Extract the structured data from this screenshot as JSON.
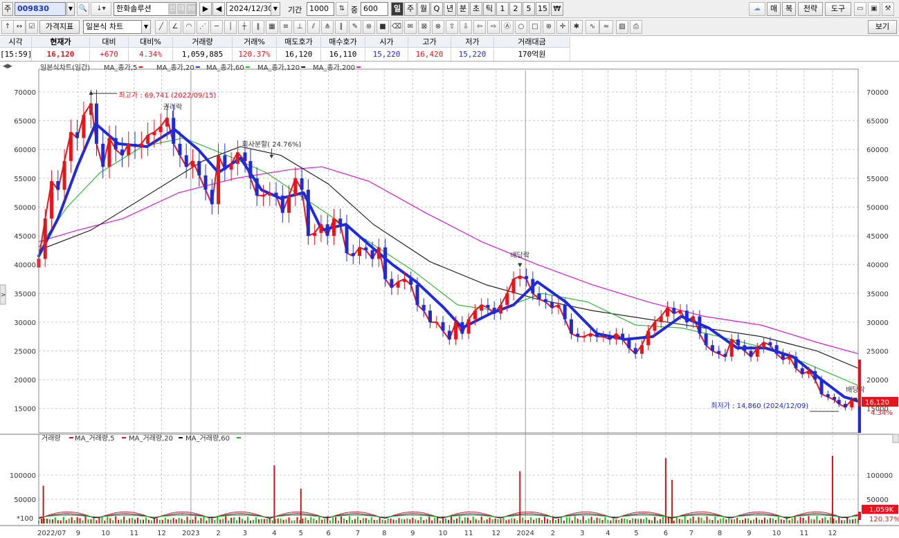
{
  "toolbar": {
    "market_label": "주",
    "code": "009830",
    "stock_name": "한화솔루션",
    "badge1": "신",
    "badge2": "대",
    "badge3": "30",
    "date": "2024/12/30",
    "period_label": "기간",
    "period_value": "1000",
    "count_label": "중",
    "count_value": "600",
    "periods": [
      "일",
      "주",
      "월",
      "Q",
      "년",
      "분",
      "초",
      "틱",
      "1",
      "2",
      "5",
      "15",
      "₩"
    ],
    "right_buttons": [
      "매",
      "복",
      "전략",
      "도구"
    ],
    "price_indicator": "가격지표",
    "chart_type": "일본식 차트",
    "view_button": "보기"
  },
  "quote": {
    "headers": [
      "시각",
      "현재가",
      "대비",
      "대비%",
      "거래량",
      "거래%",
      "매도호가",
      "매수호가",
      "시가",
      "고가",
      "저가",
      "거래대금"
    ],
    "values": [
      "[15:59]",
      "16,120",
      "+670",
      "4.34%",
      "1,059,885",
      "120.37%",
      "16,120",
      "16,110",
      "15,220",
      "16,420",
      "15,220",
      "170억원"
    ]
  },
  "colors": {
    "up": "#e8141c",
    "down": "#1f2ad8",
    "ma5": "#e8141c",
    "ma20": "#1f2ad8",
    "ma60": "#22b522",
    "ma120": "#111111",
    "ma200": "#d21ad2",
    "vol_up": "#c8141c",
    "vol_down": "#22b522",
    "vol_ma5": "#c8141c",
    "vol_ma20": "#111111",
    "vol_ma60": "#22b522"
  },
  "price_panel": {
    "legend_prefix": "일본식차트(일간)",
    "legend_items": [
      "MA_종가,5",
      "MA_종가,20",
      "MA_종가,60",
      "MA_종가,120",
      "MA_종가,200"
    ],
    "last_price_label": "16,120",
    "last_change_label": "4.34%"
  },
  "volume_panel": {
    "legend_prefix": "거래량",
    "legend_items": [
      "MA_거래량,5",
      "MA_거래량,20",
      "MA_거래량,60"
    ],
    "unit_label": "*100",
    "last_volume_label": "1,059K",
    "last_volume_pct": "120.37%"
  },
  "chart_data": {
    "type": "candlestick",
    "y_ticks": [
      15000,
      20000,
      25000,
      30000,
      35000,
      40000,
      45000,
      50000,
      55000,
      60000,
      65000,
      70000
    ],
    "ylim": [
      11000,
      73000
    ],
    "volume_ticks": [
      50000,
      100000
    ],
    "volume_ylim": [
      0,
      160000
    ],
    "x_labels": [
      "2022/07",
      "9",
      "10",
      "11",
      "12",
      "2023",
      "2",
      "3",
      "4",
      "5",
      "6",
      "7",
      "8",
      "9",
      "10",
      "11",
      "12",
      "2024",
      "2",
      "3",
      "4",
      "5",
      "6",
      "7",
      "8",
      "9",
      "10",
      "11",
      "12"
    ],
    "xlim": [
      "2022-07-20",
      "2024-12-30"
    ],
    "label_dates": [
      "2022-07-20",
      "2022-09-01",
      "2022-10-01",
      "2022-11-01",
      "2022-12-01",
      "2023-01-02",
      "2023-02-01",
      "2023-03-02",
      "2023-04-03",
      "2023-05-02",
      "2023-06-01",
      "2023-07-03",
      "2023-08-01",
      "2023-09-01",
      "2023-10-04",
      "2023-11-01",
      "2023-12-01",
      "2024-01-02",
      "2024-02-01",
      "2024-03-04",
      "2024-04-01",
      "2024-05-02",
      "2024-06-03",
      "2024-07-01",
      "2024-08-01",
      "2024-09-02",
      "2024-10-02",
      "2024-11-01",
      "2024-12-02"
    ],
    "price_series": {
      "name": "종가",
      "dates": [
        "2022-07-20",
        "2022-07-27",
        "2022-08-03",
        "2022-08-10",
        "2022-08-17",
        "2022-08-24",
        "2022-08-31",
        "2022-09-07",
        "2022-09-15",
        "2022-09-21",
        "2022-09-28",
        "2022-10-05",
        "2022-10-12",
        "2022-10-19",
        "2022-10-26",
        "2022-11-02",
        "2022-11-09",
        "2022-11-16",
        "2022-11-23",
        "2022-11-30",
        "2022-12-07",
        "2022-12-14",
        "2022-12-21",
        "2022-12-28",
        "2023-01-04",
        "2023-01-11",
        "2023-01-18",
        "2023-01-25",
        "2023-02-01",
        "2023-02-08",
        "2023-02-15",
        "2023-02-22",
        "2023-03-02",
        "2023-03-08",
        "2023-03-15",
        "2023-03-22",
        "2023-03-29",
        "2023-04-05",
        "2023-04-12",
        "2023-04-19",
        "2023-04-26",
        "2023-05-03",
        "2023-05-10",
        "2023-05-17",
        "2023-05-24",
        "2023-05-31",
        "2023-06-07",
        "2023-06-14",
        "2023-06-21",
        "2023-06-28",
        "2023-07-05",
        "2023-07-12",
        "2023-07-19",
        "2023-07-26",
        "2023-08-02",
        "2023-08-09",
        "2023-08-16",
        "2023-08-23",
        "2023-08-30",
        "2023-09-06",
        "2023-09-13",
        "2023-09-20",
        "2023-09-27",
        "2023-10-04",
        "2023-10-11",
        "2023-10-18",
        "2023-10-25",
        "2023-11-01",
        "2023-11-08",
        "2023-11-15",
        "2023-11-22",
        "2023-11-29",
        "2023-12-06",
        "2023-12-13",
        "2023-12-20",
        "2023-12-27",
        "2024-01-03",
        "2024-01-10",
        "2024-01-17",
        "2024-01-24",
        "2024-01-31",
        "2024-02-07",
        "2024-02-14",
        "2024-02-21",
        "2024-02-28",
        "2024-03-06",
        "2024-03-13",
        "2024-03-20",
        "2024-03-27",
        "2024-04-03",
        "2024-04-10",
        "2024-04-17",
        "2024-04-24",
        "2024-05-01",
        "2024-05-08",
        "2024-05-15",
        "2024-05-22",
        "2024-05-29",
        "2024-06-05",
        "2024-06-12",
        "2024-06-19",
        "2024-06-26",
        "2024-07-03",
        "2024-07-10",
        "2024-07-17",
        "2024-07-24",
        "2024-07-31",
        "2024-08-07",
        "2024-08-14",
        "2024-08-21",
        "2024-08-28",
        "2024-09-04",
        "2024-09-11",
        "2024-09-18",
        "2024-09-25",
        "2024-10-02",
        "2024-10-09",
        "2024-10-16",
        "2024-10-23",
        "2024-10-30",
        "2024-11-06",
        "2024-11-13",
        "2024-11-20",
        "2024-11-27",
        "2024-12-04",
        "2024-12-09",
        "2024-12-16",
        "2024-12-23",
        "2024-12-30"
      ],
      "close": [
        41000,
        48000,
        54500,
        53000,
        58000,
        63000,
        62000,
        66000,
        68000,
        61000,
        57000,
        62000,
        60000,
        59000,
        61000,
        60500,
        61000,
        62500,
        63000,
        64000,
        65500,
        61000,
        59000,
        57000,
        58000,
        55500,
        53000,
        50500,
        59000,
        56500,
        57500,
        59500,
        58000,
        55000,
        52000,
        52000,
        52500,
        52000,
        49000,
        52000,
        55000,
        53000,
        45000,
        45500,
        47000,
        45000,
        48000,
        47000,
        42000,
        41500,
        43000,
        42500,
        41000,
        43000,
        37500,
        36000,
        37000,
        37500,
        36500,
        33000,
        32000,
        30000,
        30000,
        28500,
        27000,
        30000,
        28000,
        30500,
        32000,
        33000,
        32500,
        31500,
        33000,
        35000,
        37500,
        38000,
        37500,
        35000,
        34000,
        33500,
        32500,
        33000,
        30500,
        28000,
        27500,
        27500,
        28000,
        27500,
        27500,
        27000,
        28000,
        27000,
        25500,
        24500,
        26000,
        28500,
        30000,
        31000,
        32500,
        31500,
        32000,
        30000,
        31000,
        28000,
        26000,
        25000,
        24500,
        24000,
        27000,
        26000,
        25000,
        24000,
        25500,
        26500,
        26000,
        24500,
        23500,
        24000,
        22000,
        21000,
        21500,
        20000,
        17500,
        17000,
        16500,
        15800,
        15200,
        16500,
        16120
      ]
    },
    "annotations": [
      {
        "text": "최고가 : 69,741 (2022/09/15)",
        "date": "2022-09-15",
        "value": 69741
      },
      {
        "text": "권리락",
        "date": "2022-12-13",
        "value": 66500
      },
      {
        "text": "회사분할( 24.76%)",
        "date": "2023-03-31",
        "value": 59800
      },
      {
        "text": "배당락",
        "date": "2023-12-27",
        "value": 40500
      },
      {
        "text": "최저가 : 14,860 (2024/12/09)",
        "date": "2024-12-09",
        "value": 14860
      },
      {
        "text": "배당락",
        "date": "2024-12-27",
        "value": 17100
      }
    ],
    "ma200_points": [
      [
        "2022-07-20",
        44000
      ],
      [
        "2022-09-01",
        46000
      ],
      [
        "2022-10-20",
        48000
      ],
      [
        "2022-12-20",
        52500
      ],
      [
        "2023-02-20",
        55000
      ],
      [
        "2023-04-20",
        56500
      ],
      [
        "2023-05-25",
        57000
      ],
      [
        "2023-07-15",
        54500
      ],
      [
        "2023-09-15",
        49000
      ],
      [
        "2023-11-15",
        44000
      ],
      [
        "2024-01-15",
        40000
      ],
      [
        "2024-03-15",
        36500
      ],
      [
        "2024-05-15",
        33500
      ],
      [
        "2024-07-15",
        31000
      ],
      [
        "2024-09-15",
        29500
      ],
      [
        "2024-11-15",
        26500
      ],
      [
        "2024-12-30",
        24500
      ]
    ],
    "ma120_points": [
      [
        "2022-07-20",
        42500
      ],
      [
        "2022-09-15",
        46000
      ],
      [
        "2022-11-15",
        52000
      ],
      [
        "2023-01-15",
        58000
      ],
      [
        "2023-02-25",
        60500
      ],
      [
        "2023-04-10",
        59000
      ],
      [
        "2023-06-01",
        54000
      ],
      [
        "2023-07-20",
        47000
      ],
      [
        "2023-09-20",
        40500
      ],
      [
        "2023-11-20",
        36500
      ],
      [
        "2024-01-15",
        34000
      ],
      [
        "2024-03-15",
        32000
      ],
      [
        "2024-05-15",
        30500
      ],
      [
        "2024-07-15",
        29000
      ],
      [
        "2024-09-15",
        27500
      ],
      [
        "2024-11-15",
        25000
      ],
      [
        "2024-12-30",
        22000
      ]
    ],
    "ma60_points": [
      [
        "2022-07-20",
        43000
      ],
      [
        "2022-08-20",
        50000
      ],
      [
        "2022-09-25",
        56000
      ],
      [
        "2022-11-10",
        60500
      ],
      [
        "2022-12-25",
        62000
      ],
      [
        "2023-02-10",
        59000
      ],
      [
        "2023-03-25",
        56000
      ],
      [
        "2023-05-20",
        50000
      ],
      [
        "2023-07-10",
        44500
      ],
      [
        "2023-09-01",
        39000
      ],
      [
        "2023-10-20",
        33000
      ],
      [
        "2023-12-01",
        32000
      ],
      [
        "2024-01-20",
        35000
      ],
      [
        "2024-03-10",
        33500
      ],
      [
        "2024-05-01",
        29500
      ],
      [
        "2024-06-20",
        29000
      ],
      [
        "2024-08-01",
        27500
      ],
      [
        "2024-09-20",
        25500
      ],
      [
        "2024-11-01",
        23000
      ],
      [
        "2024-12-30",
        19000
      ]
    ],
    "ma20_points": [
      [
        "2022-07-20",
        41500
      ],
      [
        "2022-08-10",
        48000
      ],
      [
        "2022-08-31",
        57000
      ],
      [
        "2022-09-20",
        64500
      ],
      [
        "2022-10-15",
        61000
      ],
      [
        "2022-11-15",
        60500
      ],
      [
        "2022-12-15",
        63500
      ],
      [
        "2023-01-10",
        60000
      ],
      [
        "2023-02-01",
        56000
      ],
      [
        "2023-02-25",
        58500
      ],
      [
        "2023-03-20",
        53000
      ],
      [
        "2023-04-10",
        51500
      ],
      [
        "2023-05-05",
        52500
      ],
      [
        "2023-05-25",
        46000
      ],
      [
        "2023-06-20",
        47000
      ],
      [
        "2023-07-15",
        43500
      ],
      [
        "2023-08-10",
        40000
      ],
      [
        "2023-09-05",
        37000
      ],
      [
        "2023-10-05",
        32500
      ],
      [
        "2023-10-25",
        29000
      ],
      [
        "2023-11-25",
        31500
      ],
      [
        "2023-12-20",
        33000
      ],
      [
        "2024-01-15",
        37000
      ],
      [
        "2024-02-15",
        33500
      ],
      [
        "2024-03-20",
        28000
      ],
      [
        "2024-04-20",
        27000
      ],
      [
        "2024-05-20",
        27500
      ],
      [
        "2024-06-20",
        31000
      ],
      [
        "2024-07-20",
        29000
      ],
      [
        "2024-08-20",
        25500
      ],
      [
        "2024-09-20",
        25500
      ],
      [
        "2024-10-20",
        24000
      ],
      [
        "2024-11-20",
        20000
      ],
      [
        "2024-12-15",
        17000
      ],
      [
        "2024-12-30",
        16300
      ]
    ],
    "volume_series": {
      "name": "거래량",
      "spikes": [
        {
          "date": "2022-07-25",
          "value": 78000
        },
        {
          "date": "2023-04-03",
          "value": 120000
        },
        {
          "date": "2023-05-02",
          "value": 72000
        },
        {
          "date": "2023-12-27",
          "value": 108000
        },
        {
          "date": "2024-06-03",
          "value": 135000
        },
        {
          "date": "2024-06-10",
          "value": 90000
        },
        {
          "date": "2024-12-02",
          "value": 140000
        }
      ],
      "baseline": 12000
    }
  }
}
